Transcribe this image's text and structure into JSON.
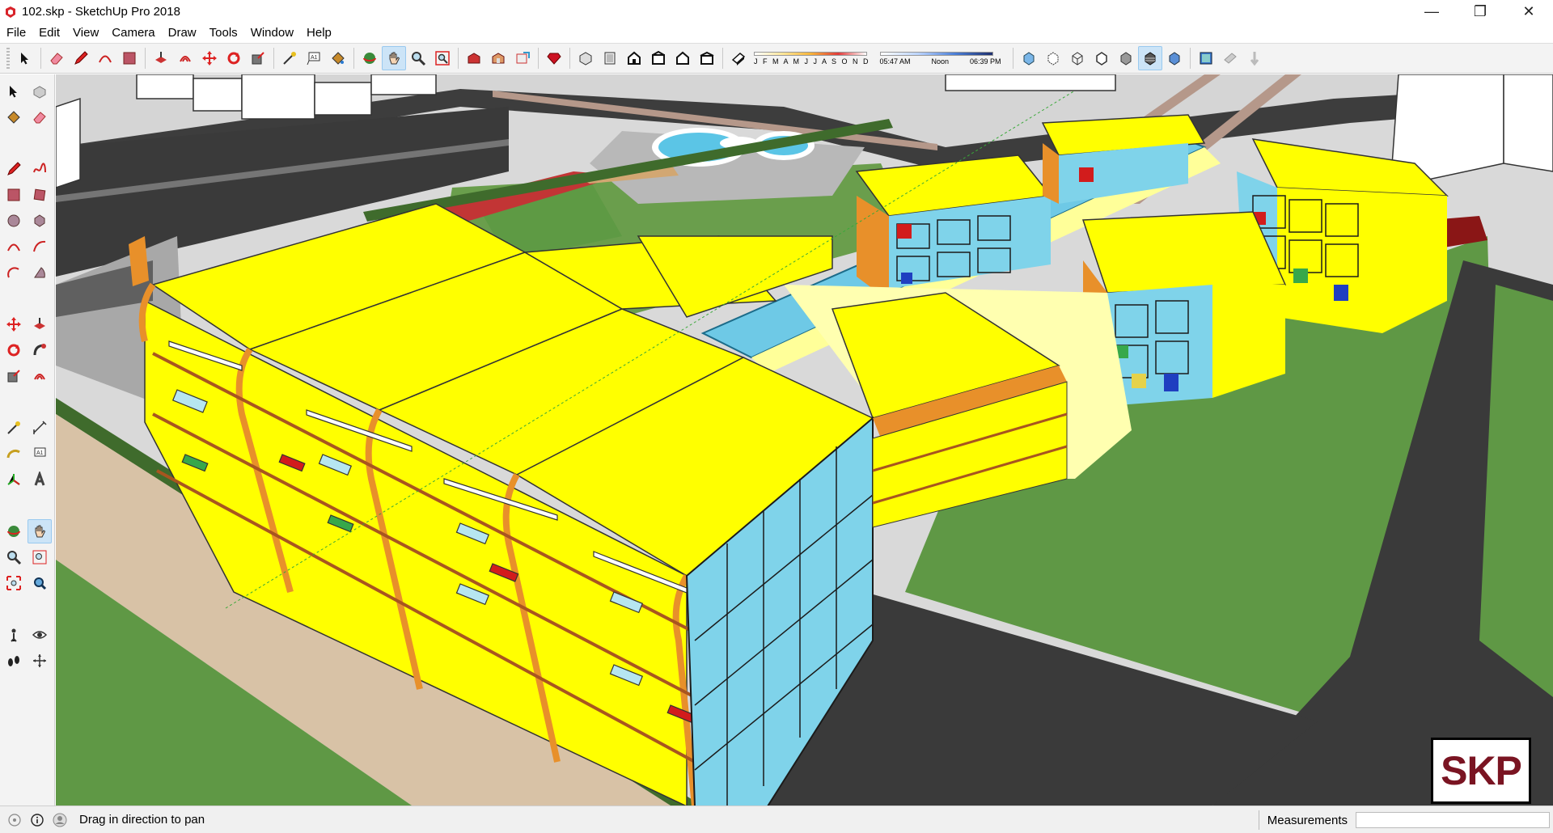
{
  "window": {
    "title": "102.skp - SketchUp Pro 2018",
    "minimize_glyph": "—",
    "maximize_glyph": "❐",
    "close_glyph": "✕"
  },
  "menu": [
    "File",
    "Edit",
    "View",
    "Camera",
    "Draw",
    "Tools",
    "Window",
    "Help"
  ],
  "toolbar": {
    "tools": [
      "select-icon",
      "eraser-icon",
      "pencil-icon",
      "arc-icon",
      "rectangle-icon",
      "push-pull-icon",
      "offset-icon",
      "move-icon",
      "rotate-icon",
      "scale-icon",
      "tape-measure-icon",
      "text-icon",
      "paint-bucket-icon",
      "orbit-icon",
      "pan-icon",
      "zoom-icon",
      "zoom-extents-icon",
      "warehouse-icon",
      "extension-warehouse-icon",
      "layout-icon",
      "ruby-icon",
      "iso-view-icon",
      "top-view-icon",
      "front-view-icon",
      "right-view-icon",
      "back-view-icon",
      "left-view-icon",
      "shadow-toggle-icon"
    ],
    "shadow_months": "J F M A M J J A S O N D",
    "shadow_time_start": "05:47 AM",
    "shadow_time_mid": "Noon",
    "shadow_time_end": "06:39 PM",
    "active_tool": "pan-icon"
  },
  "left_toolbar": {
    "active_tool": "pan-icon"
  },
  "statusbar": {
    "hint": "Drag in direction to pan",
    "measurements_label": "Measurements",
    "measurements_value": ""
  },
  "watermark": {
    "text": "SKP"
  },
  "colors": {
    "roof_yellow": "#ffff00",
    "trim_orange": "#e8902a",
    "grass": "#5f9845",
    "road": "#3a3a3a",
    "glass": "#6ec9e6"
  }
}
